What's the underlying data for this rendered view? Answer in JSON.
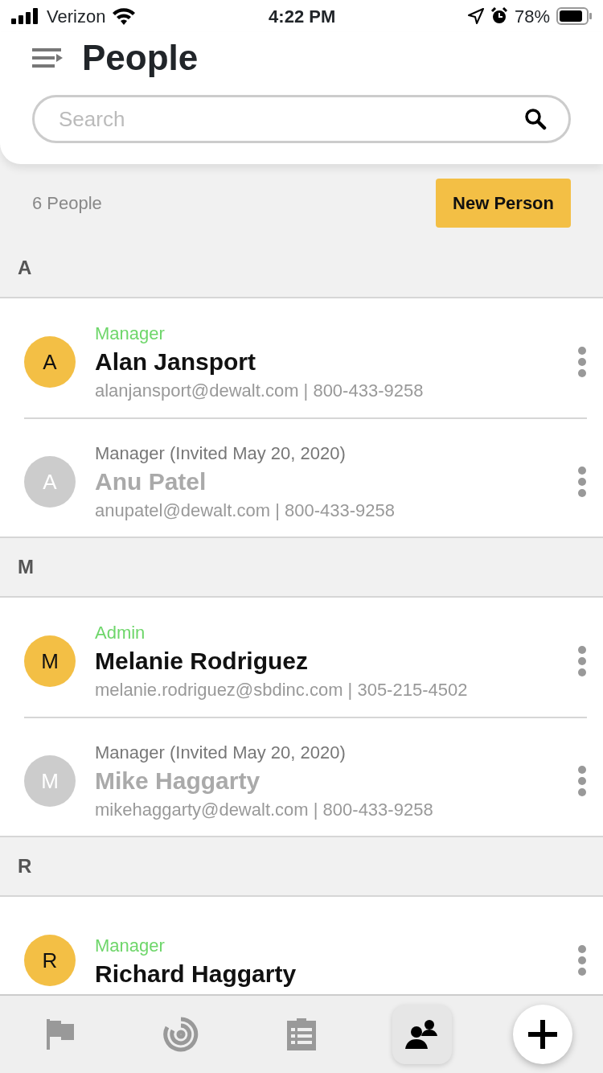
{
  "status_bar": {
    "carrier": "Verizon",
    "time": "4:22 PM",
    "battery": "78%"
  },
  "header": {
    "title": "People",
    "search": {
      "placeholder": "Search"
    }
  },
  "summary": {
    "count": "6 People",
    "button": "New Person"
  },
  "sections": [
    {
      "letter": "A",
      "people": [
        {
          "initial": "A",
          "role": "Manager",
          "name": "Alan Jansport",
          "contact": "alanjansport@dewalt.com | 800-433-9258",
          "invited": false
        },
        {
          "initial": "A",
          "role": "Manager (Invited May 20, 2020)",
          "name": "Anu Patel",
          "contact": "anupatel@dewalt.com | 800-433-9258",
          "invited": true
        }
      ]
    },
    {
      "letter": "M",
      "people": [
        {
          "initial": "M",
          "role": "Admin",
          "name": "Melanie Rodriguez",
          "contact": "melanie.rodriguez@sbdinc.com | 305-215-4502",
          "invited": false
        },
        {
          "initial": "M",
          "role": "Manager (Invited May 20, 2020)",
          "name": "Mike Haggarty",
          "contact": "mikehaggarty@dewalt.com | 800-433-9258",
          "invited": true
        }
      ]
    },
    {
      "letter": "R",
      "people": [
        {
          "initial": "R",
          "role": "Manager",
          "name": "Richard Haggarty",
          "invited": false
        }
      ]
    }
  ],
  "tabs": [
    {
      "kind": "flag",
      "selected": false
    },
    {
      "kind": "target",
      "selected": false
    },
    {
      "kind": "clipboard",
      "selected": false
    },
    {
      "kind": "people",
      "selected": true
    }
  ],
  "action_button": {
    "kind": "add"
  }
}
